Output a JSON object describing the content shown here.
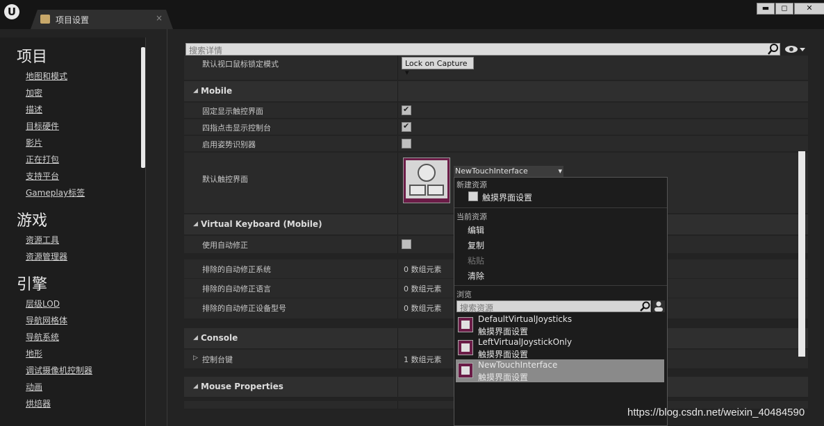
{
  "window": {
    "tab_title": "项目设置",
    "tab_close": "×",
    "logo": "U",
    "min": "▬",
    "max": "◻",
    "close": "✕"
  },
  "sidebar": {
    "sections": [
      {
        "title": "项目",
        "items": [
          "地图和模式",
          "加密",
          "描述",
          "目标硬件",
          "影片",
          "正在打包",
          "支持平台",
          "Gameplay标签"
        ]
      },
      {
        "title": "游戏",
        "items": [
          "资源工具",
          "资源管理器"
        ]
      },
      {
        "title": "引擎",
        "items": [
          "层级LOD",
          "导航网格体",
          "导航系统",
          "地形",
          "调试摄像机控制器",
          "动画",
          "烘焙器"
        ]
      }
    ]
  },
  "search": {
    "placeholder": "搜索详情"
  },
  "rows": {
    "mouse_lock_label": "默认视口鼠标锁定模式",
    "mouse_lock_value": "Lock on Capture",
    "mobile": "Mobile",
    "always_show_touch": "固定显示触控界面",
    "four_finger": "四指点击显示控制台",
    "gesture": "启用姿势识别器",
    "default_touch": "默认触控界面",
    "default_touch_value": "NewTouchInterface",
    "vkb": "Virtual Keyboard (Mobile)",
    "autocorrect": "使用自动修正",
    "excl_os": "排除的自动修正系统",
    "excl_os_val": "0 数组元素",
    "excl_lang": "排除的自动修正语言",
    "excl_lang_val": "0 数组元素",
    "excl_dev": "排除的自动修正设备型号",
    "excl_dev_val": "0 数组元素",
    "console": "Console",
    "console_keys": "控制台键",
    "console_keys_val": "1 数组元素",
    "mouse_props": "Mouse Properties"
  },
  "checks": {
    "always_show_touch": true,
    "four_finger": true,
    "gesture": false,
    "autocorrect": false
  },
  "dropdown": {
    "new_asset_header": "新建资源",
    "new_touch": "触摸界面设置",
    "current_header": "当前资源",
    "edit": "编辑",
    "copy": "复制",
    "paste": "粘贴",
    "clear": "清除",
    "browse_header": "浏览",
    "search_placeholder": "搜索资源",
    "assets": [
      {
        "name": "DefaultVirtualJoysticks",
        "type": "触摸界面设置",
        "selected": false
      },
      {
        "name": "LeftVirtualJoystickOnly",
        "type": "触摸界面设置",
        "selected": false
      },
      {
        "name": "NewTouchInterface",
        "type": "触摸界面设置",
        "selected": true
      }
    ]
  },
  "watermark": "https://blog.csdn.net/weixin_40484590"
}
